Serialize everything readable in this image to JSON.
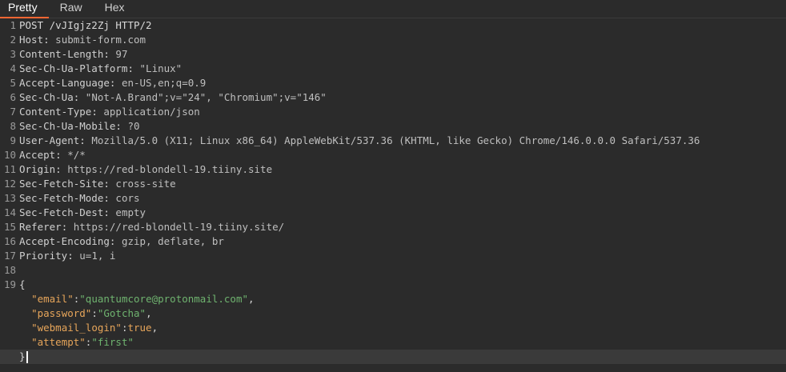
{
  "tabs": [
    {
      "label": "Pretty",
      "active": true
    },
    {
      "label": "Raw",
      "active": false
    },
    {
      "label": "Hex",
      "active": false
    }
  ],
  "request": {
    "line_numbers": [
      "1",
      "2",
      "3",
      "4",
      "5",
      "6",
      "7",
      "8",
      "9",
      "10",
      "11",
      "12",
      "13",
      "14",
      "15",
      "16",
      "17",
      "18",
      "19"
    ],
    "request_line": "POST /vJIgjz2Zj HTTP/2",
    "headers": [
      {
        "name": "Host",
        "value": "submit-form.com"
      },
      {
        "name": "Content-Length",
        "value": "97"
      },
      {
        "name": "Sec-Ch-Ua-Platform",
        "value": "\"Linux\""
      },
      {
        "name": "Accept-Language",
        "value": "en-US,en;q=0.9"
      },
      {
        "name": "Sec-Ch-Ua",
        "value": "\"Not-A.Brand\";v=\"24\", \"Chromium\";v=\"146\""
      },
      {
        "name": "Content-Type",
        "value": "application/json"
      },
      {
        "name": "Sec-Ch-Ua-Mobile",
        "value": "?0"
      },
      {
        "name": "User-Agent",
        "value": "Mozilla/5.0 (X11; Linux x86_64) AppleWebKit/537.36 (KHTML, like Gecko) Chrome/146.0.0.0 Safari/537.36"
      },
      {
        "name": "Accept",
        "value": "*/*"
      },
      {
        "name": "Origin",
        "value": "https://red-blondell-19.tiiny.site"
      },
      {
        "name": "Sec-Fetch-Site",
        "value": "cross-site"
      },
      {
        "name": "Sec-Fetch-Mode",
        "value": "cors"
      },
      {
        "name": "Sec-Fetch-Dest",
        "value": "empty"
      },
      {
        "name": "Referer",
        "value": "https://red-blondell-19.tiiny.site/"
      },
      {
        "name": "Accept-Encoding",
        "value": "gzip, deflate, br"
      },
      {
        "name": "Priority",
        "value": "u=1, i"
      }
    ],
    "body": {
      "open_brace": "{",
      "close_brace": "}",
      "fields": [
        {
          "key": "\"email\"",
          "value": "\"quantumcore@protonmail.com\"",
          "type": "string",
          "trail": ","
        },
        {
          "key": "\"password\"",
          "value": "\"Gotcha\"",
          "type": "string",
          "trail": ","
        },
        {
          "key": "\"webmail_login\"",
          "value": "true",
          "type": "bool",
          "trail": ","
        },
        {
          "key": "\"attempt\"",
          "value": "\"first\"",
          "type": "string",
          "trail": ""
        }
      ]
    }
  },
  "colors": {
    "background": "#2b2b2b",
    "active_tab_underline": "#ff6633",
    "json_key": "#e6a55a",
    "json_string": "#6fb36f",
    "current_line": "#3a3a3a"
  }
}
